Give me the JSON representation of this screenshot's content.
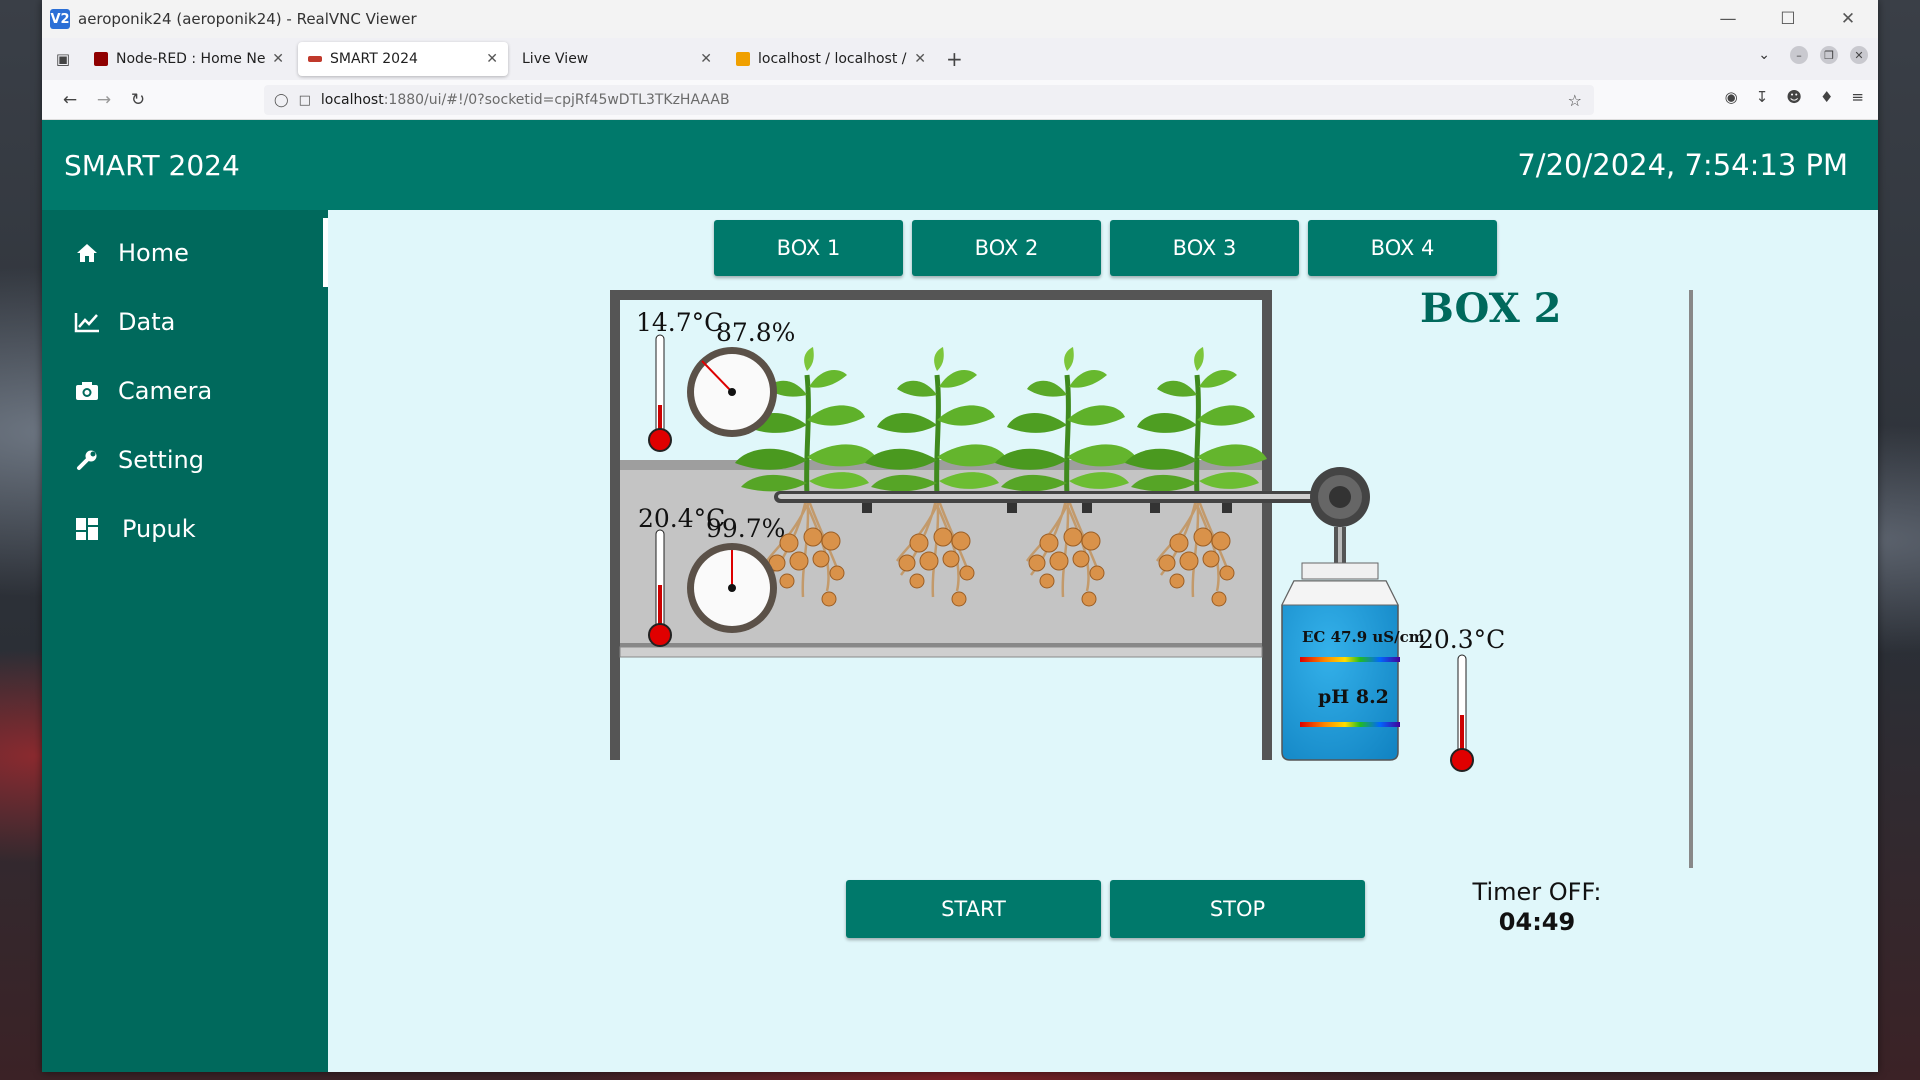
{
  "vnc": {
    "title": "aeroponik24 (aeroponik24) - RealVNC Viewer",
    "logo": "V2"
  },
  "browser": {
    "tabs": [
      {
        "label": "Node-RED : Home New",
        "favicon_color": "#8f0000"
      },
      {
        "label": "SMART 2024",
        "favicon_color": "#c0392b"
      },
      {
        "label": "Live View",
        "favicon_color": ""
      },
      {
        "label": "localhost / localhost / ae",
        "favicon_color": "#f0a000"
      }
    ],
    "url_host": "localhost",
    "url_rest": ":1880/ui/#!/0?socketid=cpjRf45wDTL3TKzHAAAB"
  },
  "dashboard": {
    "title": "SMART 2024",
    "clock": "7/20/2024, 7:54:13 PM",
    "nav": [
      {
        "label": "Home",
        "icon": "home-icon"
      },
      {
        "label": "Data",
        "icon": "line-chart-icon"
      },
      {
        "label": "Camera",
        "icon": "camera-icon"
      },
      {
        "label": "Setting",
        "icon": "wrench-icon"
      },
      {
        "label": "Pupuk",
        "icon": "dashboard-grid-icon"
      }
    ],
    "box_tabs": [
      "BOX 1",
      "BOX 2",
      "BOX 3",
      "BOX 4"
    ],
    "box_title": "BOX 2",
    "upper": {
      "temp": "14.7°C",
      "humidity": "87.8%",
      "humidity_value": 87.8
    },
    "lower": {
      "temp": "20.4°C",
      "humidity": "99.7%",
      "humidity_value": 99.7
    },
    "tank": {
      "temp": "20.3°C",
      "ec": "EC 47.9 uS/cm",
      "ph": "pH 8.2"
    },
    "controls": {
      "start": "START",
      "stop": "STOP"
    },
    "timer": {
      "label": "Timer OFF:",
      "value": "04:49"
    },
    "colors": {
      "primary": "#00796b",
      "sidebar": "#00695c",
      "background": "#e0f7fa",
      "tank": "#1e9bd7",
      "thermo_bulb": "#e00000"
    }
  }
}
